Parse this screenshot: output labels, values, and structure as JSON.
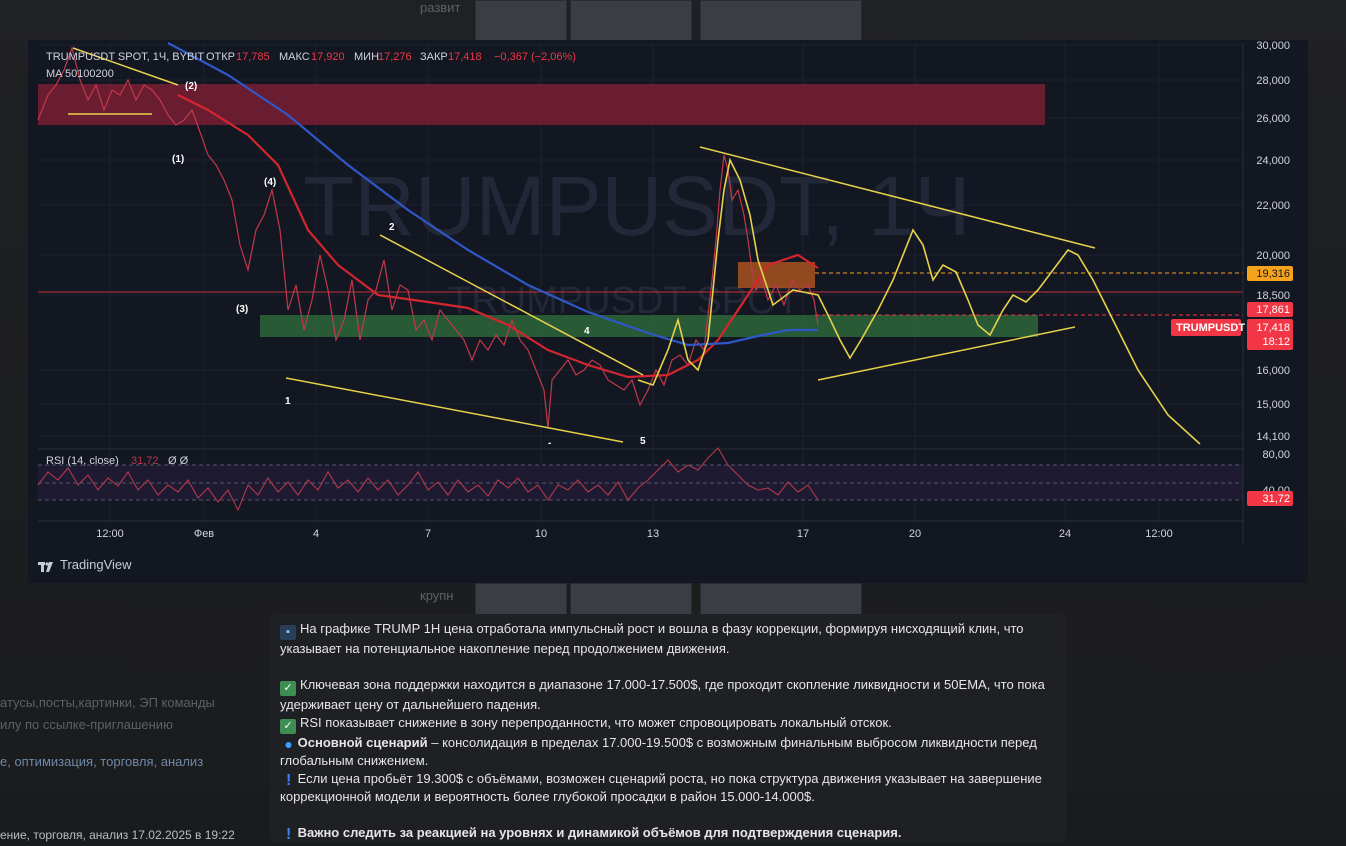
{
  "chart_header": {
    "symbol": "TRUMPUSDT SPOT, 1Ч, BYBIT",
    "open_label": "ОТКР",
    "open": "17,785",
    "high_label": "МАКС",
    "high": "17,920",
    "low_label": "МИН",
    "low": "17,276",
    "close_label": "ЗАКР",
    "close": "17,418",
    "change": "−0,367 (−2,06%)",
    "ma_label": "MA 50100200"
  },
  "watermark": {
    "big": "TRUMPUSDT, 1Ч",
    "small": "TRUMPUSDT SPOT"
  },
  "price_axis": [
    "30,000",
    "28,000",
    "26,000",
    "24,000",
    "22,000",
    "20,000",
    "18,500",
    "16,000",
    "15,000",
    "14,100"
  ],
  "price_tags": {
    "level": "19,316",
    "level_2": "17,861",
    "symbol": "TRUMPUSDT",
    "price": "17,418",
    "countdown": "18:12"
  },
  "rsi": {
    "label": "RSI (14, close)",
    "value": "31,72",
    "extra": "Ø Ø",
    "axis": [
      "80,00",
      "40,00"
    ],
    "tag": "31,72"
  },
  "time_axis": [
    "12:00",
    "Фев",
    "4",
    "7",
    "10",
    "13",
    "17",
    "20",
    "24",
    "12:00"
  ],
  "wave_labels": [
    "(2)",
    "(1)",
    "(4)",
    "(3)",
    "2",
    "1",
    "4",
    "5",
    "-"
  ],
  "tradingview": "TradingView",
  "caption": {
    "p1": "На графике TRUMP 1H цена отработала импульсный рост и вошла в фазу коррекции, формируя нисходящий клин, что указывает на потенциальное накопление перед продолжением движения.",
    "p2": "Ключевая зона поддержки находится в диапазоне 17.000-17.500$, где проходит скопление ликвидности и 50EMA, что пока удерживает цену от дальнейшего падения.",
    "p3": "RSI показывает снижение в зону перепроданности, что может спровоцировать локальный отскок.",
    "p4_bold": "Основной сценарий",
    "p4_rest": " – консолидация в пределах 17.000-19.500$ с возможным финальным выбросом ликвидности перед глобальным снижением.",
    "p5": "Если цена пробьёт 19.300$ с объёмами, возможен сценарий роста, но пока структура движения указывает на завершение коррекционной модели и вероятность более глубокой просадки в район 15.000-14.000$.",
    "p6": "Важно следить за реакцией на уровнях и динамикой объёмов для подтверждения сценария."
  },
  "background_text": {
    "left_1": "атусы,посты,картинки, ЭП команды",
    "left_2": "илу по ссылке-приглашению",
    "left_3": "е, оптимизация, торговля, анализ",
    "top_ghost": "развит",
    "mid_ghost": "крупн"
  },
  "bottom_meta": "ение, торговля, анализ   17.02.2025 в 19:22",
  "colors": {
    "chart_bg": "#131722",
    "yellow": "#e6d24a",
    "ma_red": "#d3262e",
    "ma_blue": "#2f57c8",
    "price_tag": "#f23645",
    "orange_tag": "#f7a21b"
  }
}
